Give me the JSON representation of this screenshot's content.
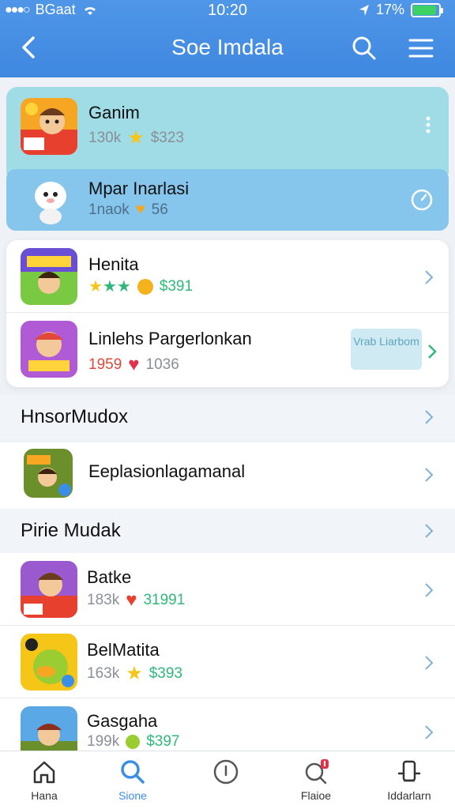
{
  "status_bar": {
    "carrier": "BGaat",
    "time": "10:20",
    "battery_pct": "17%",
    "battery_level": 0.9
  },
  "header": {
    "title": "Soe Imdala"
  },
  "featured": [
    {
      "name": "Ganim",
      "meta_left": "130k",
      "price": "$323"
    },
    {
      "name": "Mpar Inarlasi",
      "meta_left": "1naok",
      "price": "56"
    }
  ],
  "card_items": [
    {
      "name": "Henita",
      "price": "$391"
    },
    {
      "name": "Linlehs Pargerlonkan",
      "meta_left": "1959",
      "meta_right": "1036",
      "button": "Vrab Liarbom"
    }
  ],
  "sections": [
    {
      "label": "HnsorMudox",
      "items": [
        {
          "name": "Eeplasionlagamanal"
        }
      ]
    },
    {
      "label": "Pirie Mudak",
      "items": [
        {
          "name": "Batke",
          "meta_left": "183k",
          "price": "31991"
        },
        {
          "name": "BelMatita",
          "meta_left": "163k",
          "price": "$393"
        },
        {
          "name": "Gasgaha",
          "meta_left": "199k",
          "price": "$397"
        }
      ]
    }
  ],
  "tabbar": [
    {
      "label": "Hana",
      "icon": "home-icon"
    },
    {
      "label": "Sione",
      "icon": "search-icon",
      "active": true
    },
    {
      "label": "",
      "icon": "info-icon"
    },
    {
      "label": "Flaioe",
      "icon": "notification-icon"
    },
    {
      "label": "Iddarlarn",
      "icon": "profile-icon"
    }
  ],
  "colors": {
    "header": "#3f88e0",
    "featured": "#9fdce6",
    "accent": "#3b8ee6",
    "green": "#2fb87a"
  }
}
